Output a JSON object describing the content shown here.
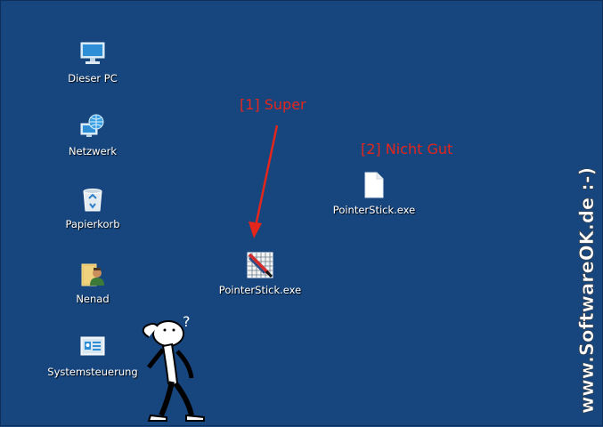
{
  "desktop": {
    "background_color": "#17467f",
    "icons": [
      {
        "id": "this-pc",
        "label": "Dieser PC",
        "icon": "monitor-icon"
      },
      {
        "id": "network",
        "label": "Netzwerk",
        "icon": "network-globe-icon"
      },
      {
        "id": "recycle-bin",
        "label": "Papierkorb",
        "icon": "recycle-bin-icon"
      },
      {
        "id": "user-folder",
        "label": "Nenad",
        "icon": "user-folder-icon"
      },
      {
        "id": "control-panel",
        "label": "Systemsteuerung",
        "icon": "control-panel-icon"
      },
      {
        "id": "pointerstick-good",
        "label": "PointerStick.exe",
        "icon": "pointerstick-app-icon"
      },
      {
        "id": "pointerstick-bad",
        "label": "PointerStick.exe",
        "icon": "blank-file-icon"
      }
    ]
  },
  "annotations": {
    "good": "[1] Super",
    "bad": "[2] Nicht Gut",
    "color": "#e3261c"
  },
  "watermark": {
    "text": "www.SoftwareOK.de :-)"
  },
  "decorations": {
    "stickman_question": "?"
  }
}
